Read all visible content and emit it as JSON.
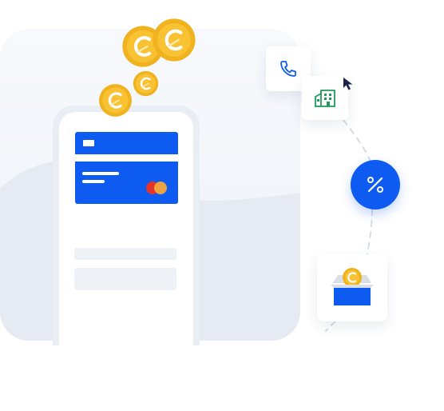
{
  "illustration": {
    "colors": {
      "accent": "#0d5bf0",
      "coin_gold": "#f9c233",
      "coin_rim": "#f0b21e",
      "background_panel": "#f2f5fa",
      "building_green": "#1f9a5a",
      "mastercard_red": "#e5342a",
      "mastercard_orange": "#f7a83a",
      "cursor": "#1b2347"
    },
    "icons": {
      "coins": "coin-icon",
      "phone": "phone-icon",
      "building": "building-icon",
      "percent": "percent-icon",
      "box": "box-icon",
      "cursor": "cursor-arrow-icon",
      "card_brand": "mastercard-icon"
    },
    "coin_count": 5
  }
}
